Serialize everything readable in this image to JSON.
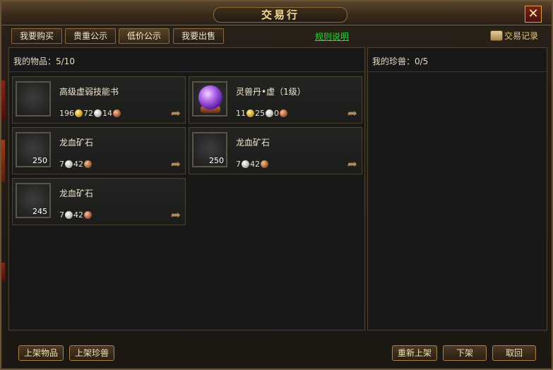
{
  "title": "交易行",
  "tabs": [
    {
      "label": "我要购买",
      "active": false
    },
    {
      "label": "贵重公示",
      "active": false
    },
    {
      "label": "低价公示",
      "active": true
    },
    {
      "label": "我要出售",
      "active": false
    }
  ],
  "rules_link": "规则说明",
  "records_label": "交易记录",
  "left_header": "我的物品：5/10",
  "right_header": "我的珍兽：0/5",
  "items": [
    {
      "name": "高级虚弱技能书",
      "count": "",
      "price": {
        "gold": "196",
        "silver": "72",
        "copper": "14"
      }
    },
    {
      "name": "灵兽丹•虚（1级）",
      "count": "",
      "price": {
        "gold": "11",
        "silver": "25",
        "copper": "0"
      }
    },
    {
      "name": "龙血矿石",
      "count": "250",
      "price": {
        "gold": "",
        "silver": "7",
        "copper": "42"
      }
    },
    {
      "name": "龙血矿石",
      "count": "250",
      "price": {
        "gold": "",
        "silver": "7",
        "copper": "42"
      }
    },
    {
      "name": "龙血矿石",
      "count": "245",
      "price": {
        "gold": "",
        "silver": "7",
        "copper": "42"
      }
    }
  ],
  "buttons": {
    "list_item": "上架物品",
    "list_pet": "上架珍兽",
    "relist": "重新上架",
    "delist": "下架",
    "cancel": "取回"
  },
  "colors": {
    "title_gold": "#f3d88e",
    "link_green": "#33d33f",
    "border_brown": "#8a6a3e"
  }
}
